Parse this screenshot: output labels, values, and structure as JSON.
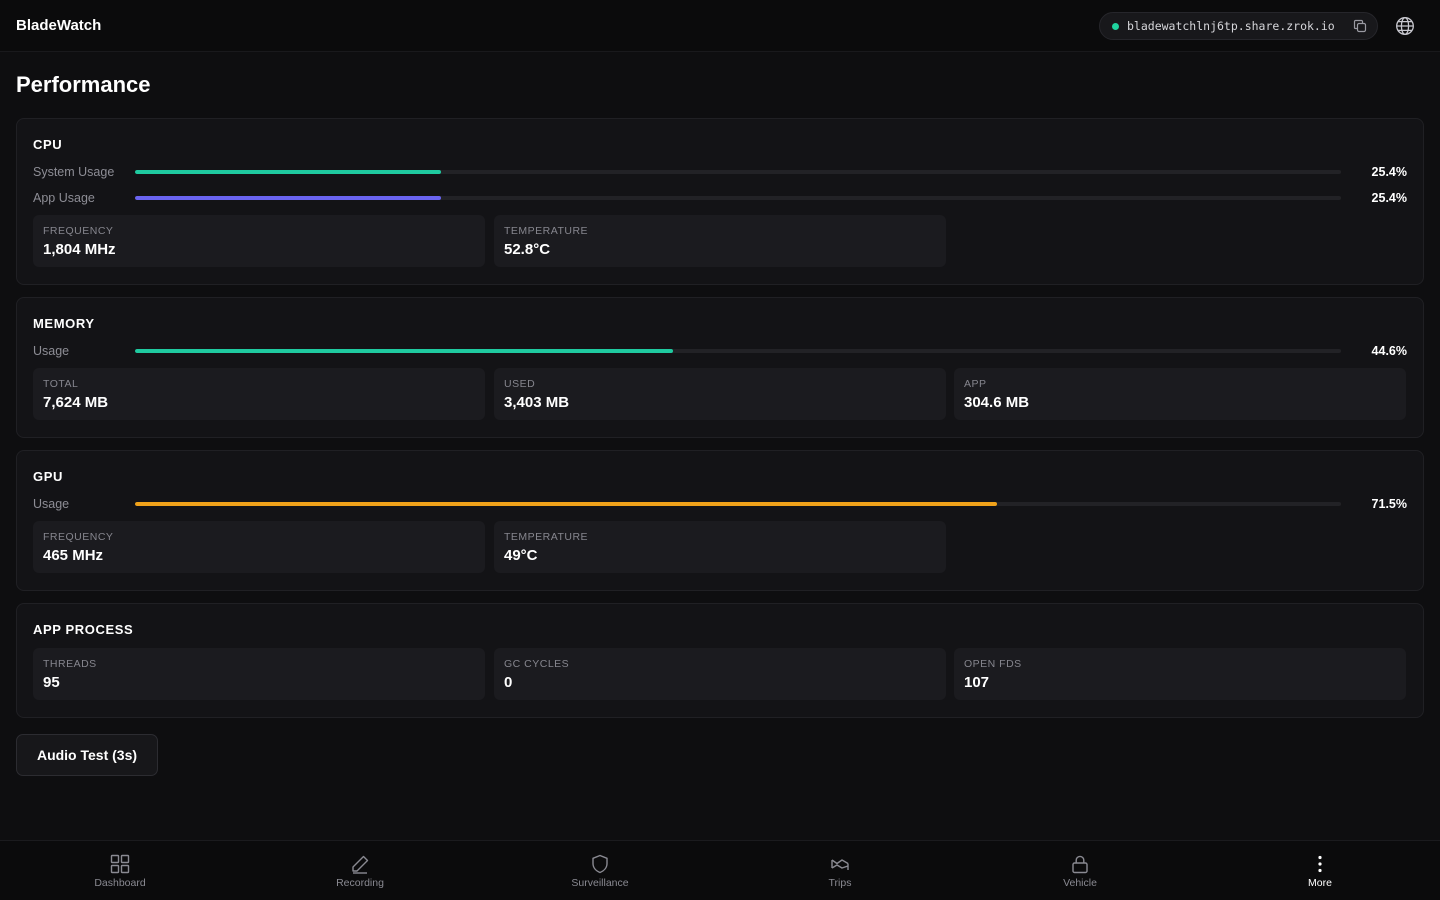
{
  "app": {
    "title": "BladeWatch"
  },
  "share": {
    "url": "bladewatchlnj6tp.share.zrok.io",
    "status_color": "#1fd39e"
  },
  "page": {
    "title": "Performance"
  },
  "cpu": {
    "title": "CPU",
    "system": {
      "label": "System Usage",
      "value": "25.4%",
      "fraction": 0.254,
      "color": "#1fcaa0"
    },
    "app": {
      "label": "App Usage",
      "value": "25.4%",
      "fraction": 0.254,
      "color": "#6a64f0"
    },
    "frequency": {
      "label": "FREQUENCY",
      "value": "1,804 MHz"
    },
    "temperature": {
      "label": "TEMPERATURE",
      "value": "52.8°C"
    }
  },
  "memory": {
    "title": "MEMORY",
    "usage": {
      "label": "Usage",
      "value": "44.6%",
      "fraction": 0.446,
      "color": "#1fcaa0"
    },
    "total": {
      "label": "TOTAL",
      "value": "7,624 MB"
    },
    "used": {
      "label": "USED",
      "value": "3,403 MB"
    },
    "app": {
      "label": "APP",
      "value": "304.6 MB"
    }
  },
  "gpu": {
    "title": "GPU",
    "usage": {
      "label": "Usage",
      "value": "71.5%",
      "fraction": 0.715,
      "color": "#f0a21a"
    },
    "frequency": {
      "label": "FREQUENCY",
      "value": "465 MHz"
    },
    "temperature": {
      "label": "TEMPERATURE",
      "value": "49°C"
    }
  },
  "process": {
    "title": "APP PROCESS",
    "threads": {
      "label": "THREADS",
      "value": "95"
    },
    "gc": {
      "label": "GC CYCLES",
      "value": "0"
    },
    "fds": {
      "label": "OPEN FDS",
      "value": "107"
    }
  },
  "actions": {
    "audio_test": "Audio Test (3s)"
  },
  "nav": {
    "items": [
      {
        "label": "Dashboard",
        "icon": "grid-icon"
      },
      {
        "label": "Recording",
        "icon": "pen-icon"
      },
      {
        "label": "Surveillance",
        "icon": "shield-icon"
      },
      {
        "label": "Trips",
        "icon": "map-icon"
      },
      {
        "label": "Vehicle",
        "icon": "lock-icon"
      },
      {
        "label": "More",
        "icon": "more-vertical-icon",
        "active": true
      }
    ]
  }
}
